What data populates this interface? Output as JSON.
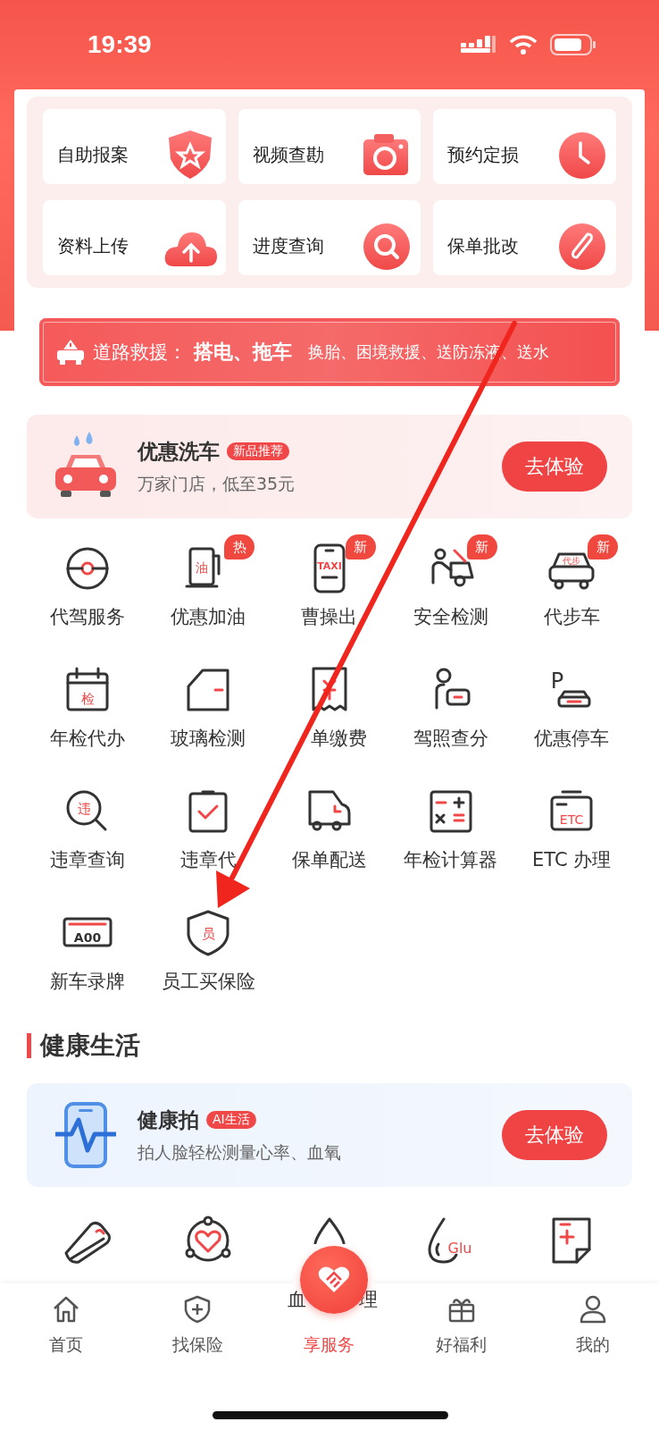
{
  "status_bar": {
    "time": "19:39"
  },
  "quick_actions": [
    {
      "label": "自助报案"
    },
    {
      "label": "视频查勘"
    },
    {
      "label": "预约定损"
    },
    {
      "label": "资料上传"
    },
    {
      "label": "进度查询"
    },
    {
      "label": "保单批改"
    }
  ],
  "rescue_banner": {
    "title": "道路救援：",
    "highlight": "搭电、拖车",
    "details": "换胎、困境救援、送防冻液、送水"
  },
  "car_wash": {
    "title": "优惠洗车",
    "tag": "新品推荐",
    "subtitle": "万家门店，低至35元",
    "button": "去体验"
  },
  "services": [
    {
      "label": "代驾服务"
    },
    {
      "label": "优惠加油",
      "icon_text": "油",
      "badge": "热"
    },
    {
      "label": "曹操出",
      "icon_text": "TAXI",
      "badge": "新"
    },
    {
      "label": "安全检测",
      "badge": "新"
    },
    {
      "label": "代步车",
      "icon_text": "代步",
      "badge": "新"
    },
    {
      "label": "年检代办",
      "icon_text": "检"
    },
    {
      "label": "玻璃检测"
    },
    {
      "label": "单缴费",
      "cut_start": true
    },
    {
      "label": "驾照查分"
    },
    {
      "label": "优惠停车",
      "icon_text": "P"
    },
    {
      "label": "违章查询",
      "icon_text": "违"
    },
    {
      "label": "违章代"
    },
    {
      "label": "保单配送"
    },
    {
      "label": "年检计算器"
    },
    {
      "label": "ETC 办理",
      "icon_text": "ETC"
    },
    {
      "label": "新车录牌",
      "icon_text": "A00"
    },
    {
      "label": "员工买保险",
      "icon_text": "员"
    }
  ],
  "health_section": {
    "title": "健康生活",
    "card": {
      "title": "健康拍",
      "tag": "AI生活",
      "subtitle": "拍人脸轻松测量心率、血氧",
      "button": "去体验"
    },
    "icons": [
      {
        "kind": "shoe"
      },
      {
        "kind": "heart"
      },
      {
        "kind": "drop",
        "label_fragments": [
          "血",
          "理"
        ]
      },
      {
        "kind": "glucose",
        "icon_text": "Glu"
      },
      {
        "kind": "report"
      }
    ]
  },
  "tab_bar": [
    {
      "label": "首页",
      "selected": false
    },
    {
      "label": "找保险",
      "selected": false
    },
    {
      "label": "享服务",
      "selected": true
    },
    {
      "label": "好福利",
      "selected": false
    },
    {
      "label": "我的",
      "selected": false
    }
  ]
}
